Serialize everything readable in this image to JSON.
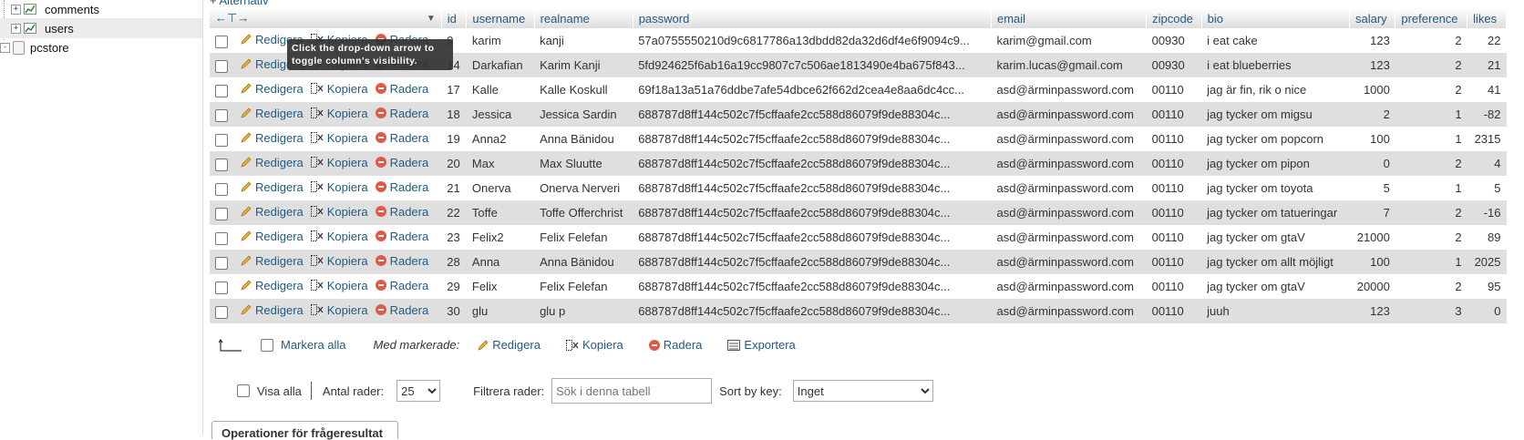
{
  "tree": {
    "items": [
      {
        "label": "comments",
        "expand": "+"
      },
      {
        "label": "users",
        "expand": "+"
      },
      {
        "label": "pcstore",
        "expand": "-"
      }
    ]
  },
  "alternativ": "+ Alternativ",
  "tooltip": "Click the drop-down arrow to toggle column's visibility.",
  "columns": [
    "id",
    "username",
    "realname",
    "password",
    "email",
    "zipcode",
    "bio",
    "salary",
    "preference",
    "likes"
  ],
  "actions": {
    "edit": "Redigera",
    "copy": "Kopiera",
    "delete": "Radera"
  },
  "rows": [
    {
      "id": "9",
      "username": "karim",
      "realname": "kanji",
      "password": "57a0755550210d9c6817786a13dbdd82da32d6df4e6f9094c9...",
      "email": "karim@gmail.com",
      "zipcode": "00930",
      "bio": "i eat cake",
      "salary": "123",
      "preference": "2",
      "likes": "22"
    },
    {
      "id": "14",
      "username": "Darkafian",
      "realname": "Karim Kanji",
      "password": "5fd924625f6ab16a19cc9807c7c506ae1813490e4ba675f843...",
      "email": "karim.lucas@gmail.com",
      "zipcode": "00930",
      "bio": "i eat blueberries",
      "salary": "123",
      "preference": "2",
      "likes": "21"
    },
    {
      "id": "17",
      "username": "Kalle",
      "realname": "Kalle Koskull",
      "password": "69f18a13a51a76ddbe7afe54dbce62f662d2cea4e8aa6dc4cc...",
      "email": "asd@ärminpassword.com",
      "zipcode": "00110",
      "bio": "jag är fin, rik o nice",
      "salary": "1000",
      "preference": "2",
      "likes": "41"
    },
    {
      "id": "18",
      "username": "Jessica",
      "realname": "Jessica Sardin",
      "password": "688787d8ff144c502c7f5cffaafe2cc588d86079f9de88304c...",
      "email": "asd@ärminpassword.com",
      "zipcode": "00110",
      "bio": "jag tycker om migsu",
      "salary": "2",
      "preference": "1",
      "likes": "-82"
    },
    {
      "id": "19",
      "username": "Anna2",
      "realname": "Anna Bänidou",
      "password": "688787d8ff144c502c7f5cffaafe2cc588d86079f9de88304c...",
      "email": "asd@ärminpassword.com",
      "zipcode": "00110",
      "bio": "jag tycker om popcorn",
      "salary": "100",
      "preference": "1",
      "likes": "2315"
    },
    {
      "id": "20",
      "username": "Max",
      "realname": "Max Sluutte",
      "password": "688787d8ff144c502c7f5cffaafe2cc588d86079f9de88304c...",
      "email": "asd@ärminpassword.com",
      "zipcode": "00110",
      "bio": "jag tycker om pipon",
      "salary": "0",
      "preference": "2",
      "likes": "4"
    },
    {
      "id": "21",
      "username": "Onerva",
      "realname": "Onerva Nerveri",
      "password": "688787d8ff144c502c7f5cffaafe2cc588d86079f9de88304c...",
      "email": "asd@ärminpassword.com",
      "zipcode": "00110",
      "bio": "jag tycker om toyota",
      "salary": "5",
      "preference": "1",
      "likes": "5"
    },
    {
      "id": "22",
      "username": "Toffe",
      "realname": "Toffe Offerchrist",
      "password": "688787d8ff144c502c7f5cffaafe2cc588d86079f9de88304c...",
      "email": "asd@ärminpassword.com",
      "zipcode": "00110",
      "bio": "jag tycker om tatueringar",
      "salary": "7",
      "preference": "2",
      "likes": "-16"
    },
    {
      "id": "23",
      "username": "Felix2",
      "realname": "Felix Felefan",
      "password": "688787d8ff144c502c7f5cffaafe2cc588d86079f9de88304c...",
      "email": "asd@ärminpassword.com",
      "zipcode": "00110",
      "bio": "jag tycker om gtaV",
      "salary": "21000",
      "preference": "2",
      "likes": "89"
    },
    {
      "id": "28",
      "username": "Anna",
      "realname": "Anna Bänidou",
      "password": "688787d8ff144c502c7f5cffaafe2cc588d86079f9de88304c...",
      "email": "asd@ärminpassword.com",
      "zipcode": "00110",
      "bio": "jag tycker om allt möjligt",
      "salary": "100",
      "preference": "1",
      "likes": "2025"
    },
    {
      "id": "29",
      "username": "Felix",
      "realname": "Felix Felefan",
      "password": "688787d8ff144c502c7f5cffaafe2cc588d86079f9de88304c...",
      "email": "asd@ärminpassword.com",
      "zipcode": "00110",
      "bio": "jag tycker om gtaV",
      "salary": "20000",
      "preference": "2",
      "likes": "95"
    },
    {
      "id": "30",
      "username": "glu",
      "realname": "glu p",
      "password": "688787d8ff144c502c7f5cffaafe2cc588d86079f9de88304c...",
      "email": "asd@ärminpassword.com",
      "zipcode": "00110",
      "bio": "juuh",
      "salary": "123",
      "preference": "3",
      "likes": "0"
    }
  ],
  "bulk": {
    "select_all": "Markera alla",
    "with_selected": "Med markerade:",
    "edit": "Redigera",
    "copy": "Kopiera",
    "delete": "Radera",
    "export": "Exportera"
  },
  "options": {
    "show_all": "Visa alla",
    "num_rows_label": "Antal rader:",
    "num_rows_value": "25",
    "filter_label": "Filtrera rader:",
    "filter_placeholder": "Sök i denna tabell",
    "sort_label": "Sort by key:",
    "sort_value": "Inget"
  },
  "ops_tab": "Operationer för frågeresultat",
  "colors": {
    "link": "#235a81",
    "row_alt": "#dfdfdf",
    "delete": "#e05a4a"
  }
}
